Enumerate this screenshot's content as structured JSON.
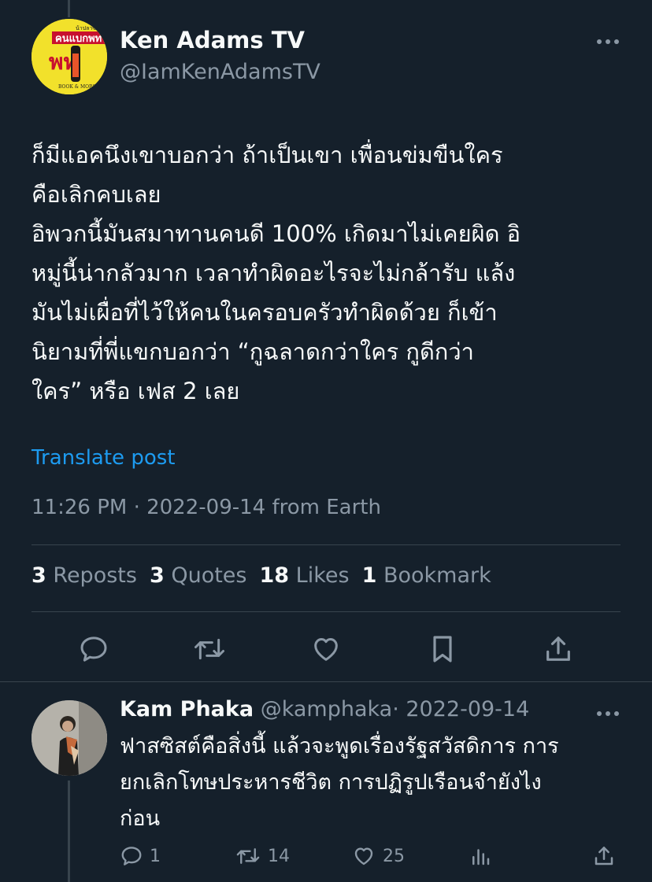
{
  "post": {
    "author_name": "Ken Adams TV",
    "author_handle": "@IamKenAdamsTV",
    "avatar_text_top": "น้าปลาซิ่ว",
    "avatar_text_main": "คนแบกพท",
    "avatar_text_big": "พท",
    "avatar_text_bottom": "BOOK & MOBSTER",
    "text_lines": [
      "ก็มีแอคนึงเขาบอกว่า ถ้าเป็นเขา เพื่อนข่มขืนใคร",
      "คือเลิกคบเลย",
      "อิพวกนี้มันสมาทานคนดี 100% เกิดมาไม่เคยผิด อิ",
      "หมู่นี้น่ากลัวมาก เวลาทำผิดอะไรจะไม่กล้ารับ แล้ง",
      "มันไม่เผื่อที่ไว้ให้คนในครอบครัวทำผิดด้วย ก็เข้า",
      "นิยามที่พี่แขกบอกว่า “กูฉลาดกว่าใคร กูดีกว่า",
      "ใคร” หรือ เฟส 2 เลย"
    ],
    "translate_label": "Translate post",
    "meta": "11:26 PM · 2022-09-14 from Earth",
    "stats": {
      "reposts_count": "3",
      "reposts_label": "Reposts",
      "quotes_count": "3",
      "quotes_label": "Quotes",
      "likes_count": "18",
      "likes_label": "Likes",
      "bookmarks_count": "1",
      "bookmarks_label": "Bookmark"
    },
    "actions": [
      "reply-icon",
      "repost-icon",
      "like-icon",
      "bookmark-icon",
      "share-icon"
    ]
  },
  "reply": {
    "author_name": "Kam Phaka",
    "author_handle": "@kamphaka",
    "date": "· 2022-09-14",
    "text_lines": [
      "ฟาสซิสต์คือสิ่งนี้ แล้วจะพูดเรื่องรัฐสวัสดิการ การ",
      "ยกเลิกโทษประหารชีวิต การปฏิรูปเรือนจำยังไง",
      "ก่อน"
    ],
    "reply_count": "1",
    "repost_count": "14",
    "like_count": "25"
  },
  "colors": {
    "background": "#15202b",
    "text": "#f7f9f9",
    "secondary": "#8b98a5",
    "link": "#1d9bf0",
    "divider": "#38444d"
  }
}
